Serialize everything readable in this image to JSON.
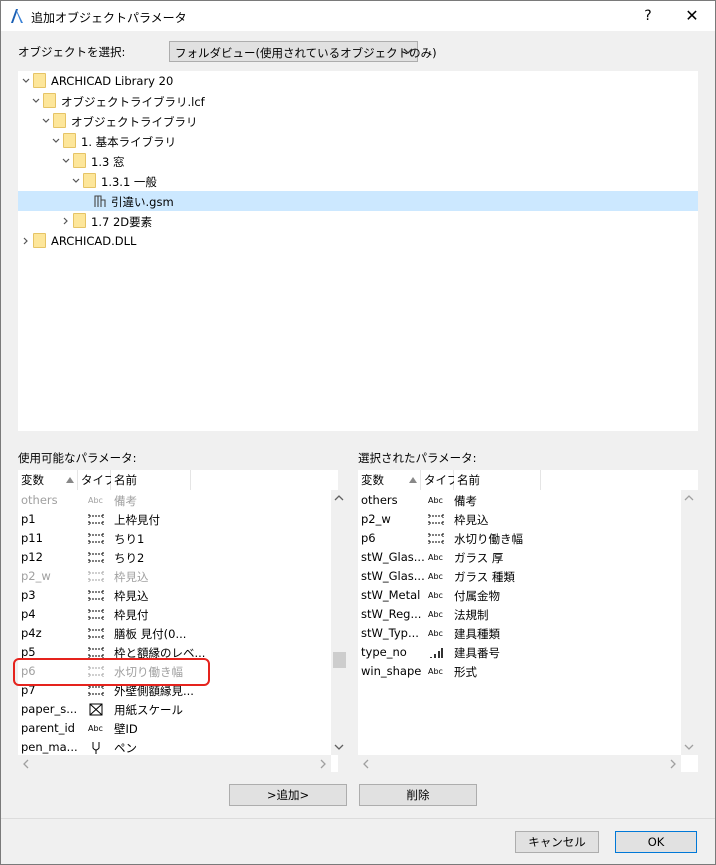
{
  "window": {
    "title": "追加オブジェクトパラメータ",
    "help": "?",
    "close": "✕"
  },
  "selector": {
    "label": "オブジェクトを選択:",
    "value": "フォルダビュー(使用されているオブジェクトのみ)"
  },
  "tree": [
    {
      "label": "ARCHICAD Library 20",
      "depth": 0,
      "expanded": true
    },
    {
      "label": "オブジェクトライブラリ.lcf",
      "depth": 1,
      "expanded": true
    },
    {
      "label": "オブジェクトライブラリ",
      "depth": 2,
      "expanded": true
    },
    {
      "label": "1. 基本ライブラリ",
      "depth": 3,
      "expanded": true
    },
    {
      "label": "1.3 窓",
      "depth": 4,
      "expanded": true
    },
    {
      "label": "1.3.1 一般",
      "depth": 5,
      "expanded": true
    },
    {
      "label": "引違い.gsm",
      "depth": 6,
      "selected": true
    },
    {
      "label": "1.7 2D要素",
      "depth": 4,
      "expanded": false
    },
    {
      "label": "ARCHICAD.DLL",
      "depth": 0,
      "expanded": false
    }
  ],
  "available": {
    "label": "使用可能なパラメータ:",
    "headers": [
      "変数",
      "タイプ",
      "名前"
    ],
    "rows": [
      {
        "var": "others",
        "type": "abc",
        "name": "備考",
        "disabled": true
      },
      {
        "var": "p1",
        "type": "len",
        "name": "上枠見付"
      },
      {
        "var": "p11",
        "type": "len",
        "name": "ちり1"
      },
      {
        "var": "p12",
        "type": "len",
        "name": "ちり2"
      },
      {
        "var": "p2_w",
        "type": "len",
        "name": "枠見込",
        "disabled": true
      },
      {
        "var": "p3",
        "type": "len",
        "name": "枠見込"
      },
      {
        "var": "p4",
        "type": "len",
        "name": "枠見付"
      },
      {
        "var": "p4z",
        "type": "len",
        "name": "膳板 見付(0..."
      },
      {
        "var": "p5",
        "type": "len",
        "name": "枠と額縁のレベ..."
      },
      {
        "var": "p6",
        "type": "len",
        "name": "水切り働き幅",
        "disabled": true
      },
      {
        "var": "p7",
        "type": "len",
        "name": "外壁側額縁見..."
      },
      {
        "var": "paper_s...",
        "type": "scale",
        "name": "用紙スケール"
      },
      {
        "var": "parent_id",
        "type": "abc",
        "name": "壁ID"
      },
      {
        "var": "pen_ma...",
        "type": "pen",
        "name": "ペン"
      }
    ]
  },
  "selected": {
    "label": "選択されたパラメータ:",
    "headers": [
      "変数",
      "タイプ",
      "名前"
    ],
    "rows": [
      {
        "var": "others",
        "type": "abc",
        "name": "備考"
      },
      {
        "var": "p2_w",
        "type": "len",
        "name": "枠見込"
      },
      {
        "var": "p6",
        "type": "len",
        "name": "水切り働き幅"
      },
      {
        "var": "stW_Glas...",
        "type": "abc",
        "name": "ガラス 厚"
      },
      {
        "var": "stW_Glas...",
        "type": "abc",
        "name": "ガラス 種類"
      },
      {
        "var": "stW_Metal",
        "type": "abc",
        "name": "付属金物"
      },
      {
        "var": "stW_Reg...",
        "type": "abc",
        "name": "法規制"
      },
      {
        "var": "stW_Typ...",
        "type": "abc",
        "name": "建具種類"
      },
      {
        "var": "type_no",
        "type": "int",
        "name": "建具番号"
      },
      {
        "var": "win_shape",
        "type": "abc",
        "name": "形式"
      }
    ]
  },
  "buttons": {
    "add": ">追加>",
    "remove": "削除",
    "cancel": "キャンセル",
    "ok": "OK"
  },
  "type_icons": {
    "abc": "Abc"
  },
  "colors": {
    "selection": "#cce8ff",
    "highlight": "#e5231d",
    "accent": "#0078d7"
  }
}
